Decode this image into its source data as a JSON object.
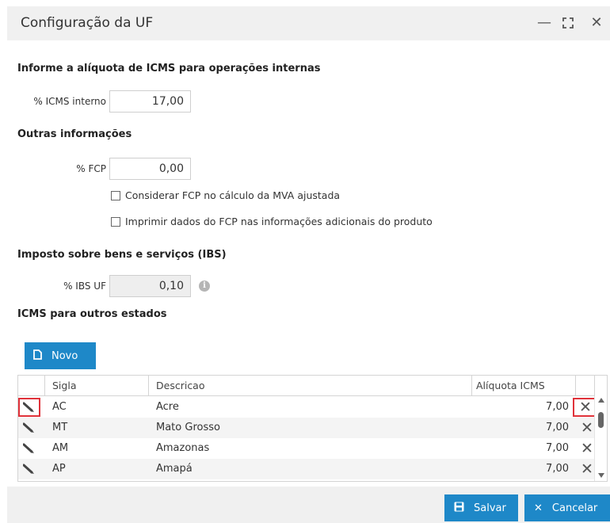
{
  "window": {
    "title": "Configuração da UF",
    "controls": {
      "minimize": "—",
      "maximize": "⛶",
      "close": "✕"
    }
  },
  "icms_interno": {
    "section_title": "Informe a alíquota de ICMS para operações internas",
    "label": "% ICMS interno",
    "value": "17,00"
  },
  "outras": {
    "section_title": "Outras informações",
    "fcp_label": "% FCP",
    "fcp_value": "0,00",
    "chk_mva_label": "Considerar FCP no cálculo da MVA ajustada",
    "chk_mva_checked": false,
    "chk_imprimir_label": "Imprimir dados do FCP nas informações adicionais do produto",
    "chk_imprimir_checked": false
  },
  "ibs": {
    "section_title": "Imposto sobre bens e serviços (IBS)",
    "label": "% IBS UF",
    "value": "0,10",
    "info_icon": "i"
  },
  "outros_estados": {
    "section_title": "ICMS para outros estados",
    "novo_label": "Novo"
  },
  "grid": {
    "columns": {
      "sigla": "Sigla",
      "descricao": "Descricao",
      "aliquota": "Alíquota ICMS"
    },
    "rows": [
      {
        "sigla": "AC",
        "descricao": "Acre",
        "aliquota": "7,00"
      },
      {
        "sigla": "MT",
        "descricao": "Mato Grosso",
        "aliquota": "7,00"
      },
      {
        "sigla": "AM",
        "descricao": "Amazonas",
        "aliquota": "7,00"
      },
      {
        "sigla": "AP",
        "descricao": "Amapá",
        "aliquota": "7,00"
      }
    ]
  },
  "footer": {
    "salvar_label": "Salvar",
    "cancelar_label": "Cancelar"
  },
  "colors": {
    "primary": "#1e88c8",
    "highlight": "#e0323a",
    "titlebar": "#f0f0f0"
  }
}
